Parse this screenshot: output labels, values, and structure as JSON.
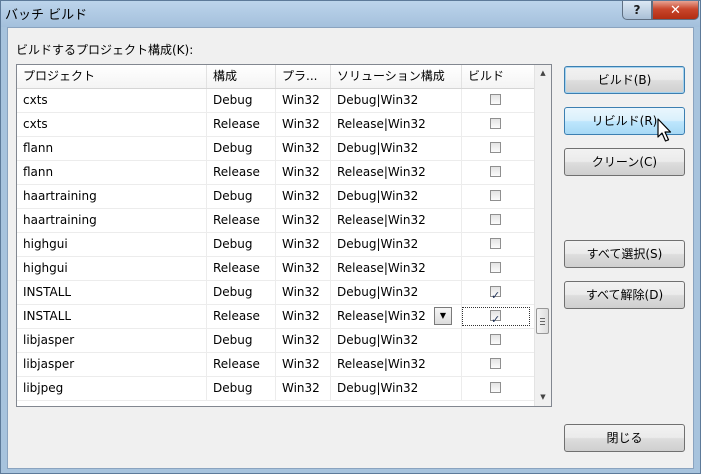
{
  "window": {
    "title": "バッチ ビルド",
    "help_label": "?",
    "close_label": "✕"
  },
  "list_label": "ビルドするプロジェクト構成(K):",
  "columns": [
    "プロジェクト",
    "構成",
    "プラ...",
    "ソリューション構成",
    "ビルド"
  ],
  "rows": [
    {
      "project": "cxts",
      "config": "Debug",
      "platform": "Win32",
      "solution_config": "Debug|Win32",
      "build": false
    },
    {
      "project": "cxts",
      "config": "Release",
      "platform": "Win32",
      "solution_config": "Release|Win32",
      "build": false
    },
    {
      "project": "flann",
      "config": "Debug",
      "platform": "Win32",
      "solution_config": "Debug|Win32",
      "build": false
    },
    {
      "project": "flann",
      "config": "Release",
      "platform": "Win32",
      "solution_config": "Release|Win32",
      "build": false
    },
    {
      "project": "haartraining",
      "config": "Debug",
      "platform": "Win32",
      "solution_config": "Debug|Win32",
      "build": false
    },
    {
      "project": "haartraining",
      "config": "Release",
      "platform": "Win32",
      "solution_config": "Release|Win32",
      "build": false
    },
    {
      "project": "highgui",
      "config": "Debug",
      "platform": "Win32",
      "solution_config": "Debug|Win32",
      "build": false
    },
    {
      "project": "highgui",
      "config": "Release",
      "platform": "Win32",
      "solution_config": "Release|Win32",
      "build": false
    },
    {
      "project": "INSTALL",
      "config": "Debug",
      "platform": "Win32",
      "solution_config": "Debug|Win32",
      "build": true
    },
    {
      "project": "INSTALL",
      "config": "Release",
      "platform": "Win32",
      "solution_config": "Release|Win32",
      "build": true,
      "selected": true
    },
    {
      "project": "libjasper",
      "config": "Debug",
      "platform": "Win32",
      "solution_config": "Debug|Win32",
      "build": false
    },
    {
      "project": "libjasper",
      "config": "Release",
      "platform": "Win32",
      "solution_config": "Release|Win32",
      "build": false
    },
    {
      "project": "libjpeg",
      "config": "Debug",
      "platform": "Win32",
      "solution_config": "Debug|Win32",
      "build": false
    }
  ],
  "buttons": {
    "build": "ビルド(B)",
    "rebuild": "リビルド(R)",
    "clean": "クリーン(C)",
    "select_all": "すべて選択(S)",
    "deselect_all": "すべて解除(D)",
    "close": "閉じる"
  },
  "icons": {
    "dropdown": "chevron-down-icon",
    "scroll_up": "triangle-up-icon",
    "scroll_down": "triangle-down-icon",
    "cursor": "arrow-cursor-icon"
  }
}
